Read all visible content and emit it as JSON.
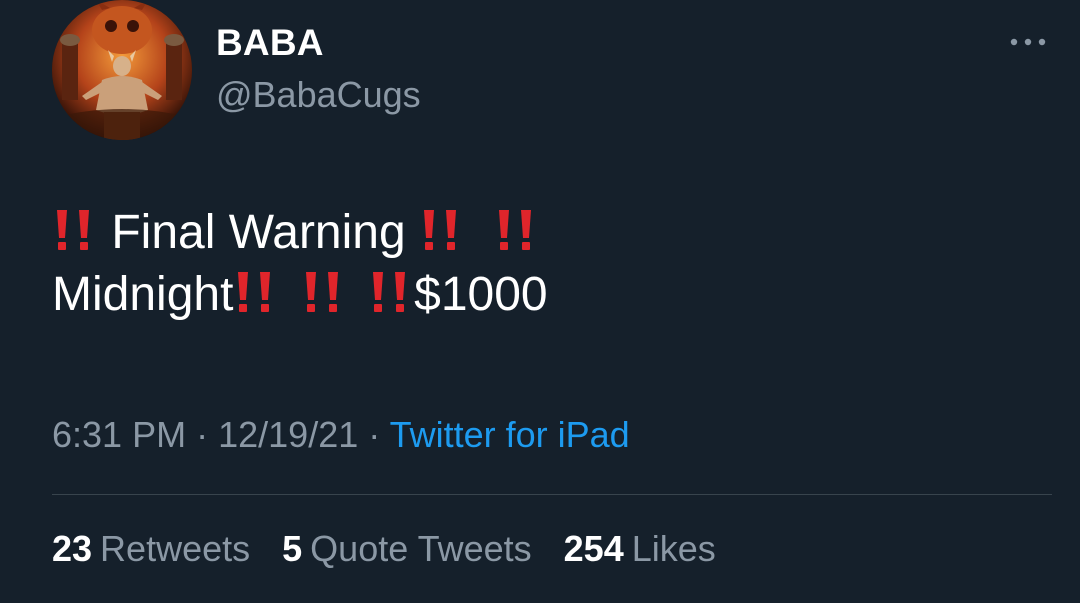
{
  "user": {
    "display_name": "BABA",
    "handle": "@BabaCugs",
    "avatar_icon": "demon-figure-avatar"
  },
  "menu": {
    "icon": "more-horizontal-icon"
  },
  "tweet": {
    "line1_text": "Final Warning",
    "line2_text": "Midnight",
    "line2_suffix": "$1000",
    "emoji": "double-exclamation-mark-emoji"
  },
  "meta": {
    "time": "6:31 PM",
    "separator": "·",
    "date": "12/19/21",
    "source": "Twitter for iPad"
  },
  "stats": {
    "retweets_count": "23",
    "retweets_label": "Retweets",
    "quotes_count": "5",
    "quotes_label": "Quote Tweets",
    "likes_count": "254",
    "likes_label": "Likes"
  },
  "colors": {
    "background": "#15202b",
    "secondary_text": "#8b98a5",
    "link": "#1d9bf0",
    "emoji_red": "#e0252b"
  }
}
